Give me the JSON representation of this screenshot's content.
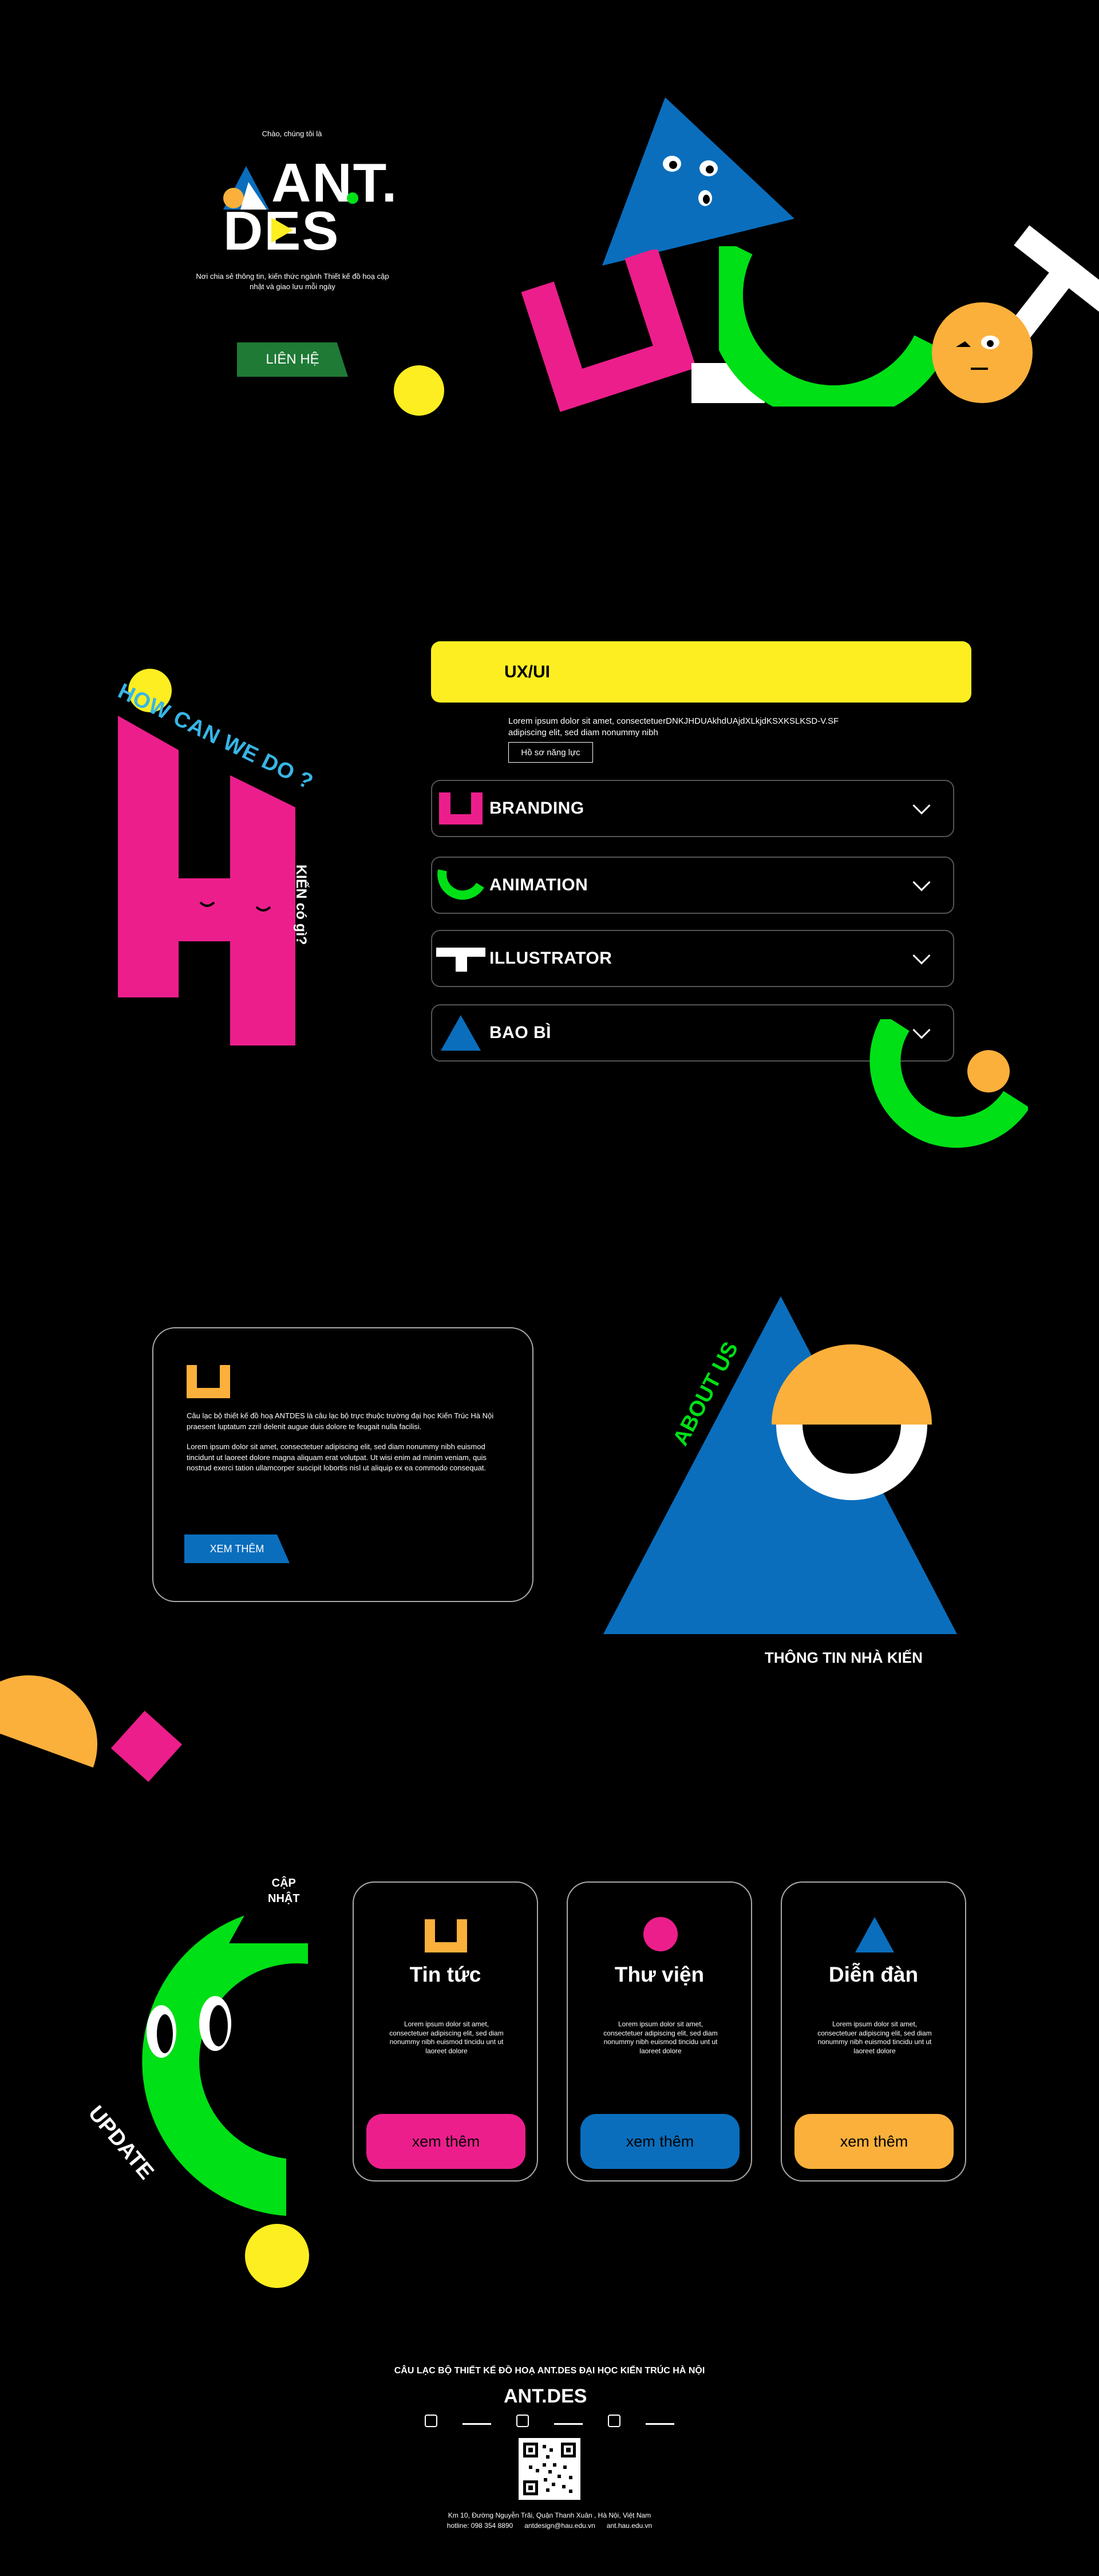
{
  "colors": {
    "background": "#000000",
    "yellow": "#fcee21",
    "blue": "#0a6ebd",
    "pink": "#ec1e8c",
    "green": "#00e016",
    "orange": "#fbb03b",
    "dark_green": "#1f7a36"
  },
  "hero": {
    "greeting": "Chào, chúng tôi là",
    "logo_line1": "ANT.",
    "logo_line2": "DES",
    "tagline": "Nơi chia sẻ thông tin, kiến thức ngành Thiết kế đồ hoạ cập nhật và giao lưu mỗi ngày",
    "contact_label": "LIÊN HỆ"
  },
  "services": {
    "side_title": "HOW CAN WE DO ?",
    "side_question": "KIẾN có gì?",
    "open_item": {
      "label": "UX/UI",
      "description": "Lorem ipsum dolor sit amet, consectetuerDNKJHDUAkhdUAjdXLkjdKSXKSLKSD-V.SF adipiscing elit, sed diam nonummy nibh",
      "profile_button": "Hồ sơ năng lực"
    },
    "items": [
      {
        "label": "BRANDING",
        "icon": "pink-bracket-icon"
      },
      {
        "label": "ANIMATION",
        "icon": "green-arc-icon"
      },
      {
        "label": "ILLUSTRATOR",
        "icon": "white-t-icon"
      },
      {
        "label": "BAO BÌ",
        "icon": "blue-triangle-icon"
      }
    ]
  },
  "about": {
    "paragraph1": "Câu lạc bộ thiết kế đồ hoạ ANTDES là câu lạc bộ trực thuộc trường đại học Kiến Trúc Hà Nội praesent luptatum zzril delenit augue duis dolore te feugait nulla facilisi.",
    "paragraph2": "Lorem ipsum dolor sit amet, consectetuer adipiscing elit, sed diam nonummy nibh euismod tincidunt ut laoreet dolore magna aliquam erat volutpat. Ut wisi enim ad minim veniam, quis nostrud exerci tation ullamcorper suscipit lobortis nisl ut aliquip ex ea commodo consequat.",
    "button_label": "XEM THÊM",
    "side_title": "ABOUT US",
    "caption": "THÔNG TIN NHÀ KIẾN"
  },
  "update": {
    "caption_line1": "CẬP",
    "caption_line2": "NHẬT",
    "side_word": "UPDATE",
    "cards": [
      {
        "title": "Tin tức",
        "text": "Lorem ipsum dolor sit amet, consectetuer adipiscing elit, sed diam nonummy nibh euismod tincidu unt ut laoreet dolore",
        "button": "xem thêm",
        "color": "#ec1e8c",
        "icon": "orange-bracket-icon"
      },
      {
        "title": "Thư viện",
        "text": "Lorem ipsum dolor sit amet, consectetuer adipiscing elit, sed diam nonummy nibh euismod tincidu unt ut laoreet dolore",
        "button": "xem thêm",
        "color": "#0a6ebd",
        "icon": "pink-circle-icon"
      },
      {
        "title": "Diễn đàn",
        "text": "Lorem ipsum dolor sit amet, consectetuer adipiscing elit, sed diam nonummy nibh euismod tincidu unt ut laoreet dolore",
        "button": "xem thêm",
        "color": "#fbb03b",
        "icon": "blue-triangle-icon"
      }
    ]
  },
  "footer": {
    "title": "CÂU LẠC BỘ THIẾT KẾ ĐỒ HOẠ ANT.DES ĐẠI HỌC KIẾN TRÚC HÀ NỘI",
    "logo": "ANT.DES",
    "address": "Km 10, Đường Nguyễn Trãi, Quận Thanh Xuân , Hà Nội, Việt Nam",
    "contacts": "hotline: 098 354 8890      antdesign@hau.edu.vn      ant.hau.edu.vn"
  }
}
